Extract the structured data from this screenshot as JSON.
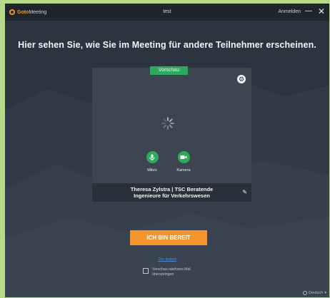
{
  "titlebar": {
    "brand": "Goto",
    "product": "Meeting",
    "title": "test",
    "signin_label": "Anmelden",
    "minimize_glyph": "—",
    "close_glyph": "✕"
  },
  "headline": "Hier sehen Sie, wie Sie im Meeting für andere Teilnehmer erscheinen.",
  "preview": {
    "tag": "Vorschau",
    "settings_icon": "gear-icon",
    "controls": {
      "mic_label": "Mikro",
      "camera_label": "Kamera"
    },
    "name_line1": "Theresa Zylstra | TSC Beratende",
    "name_line2": "Ingenieure für Verkehrswesen"
  },
  "ready_button": "ICH BIN BEREIT",
  "test_link": "Ton testen",
  "skip": {
    "line1": "Vorschau nächstes Mal",
    "line2": "überspringen"
  },
  "language": "Deutsch",
  "colors": {
    "accent_orange": "#f5942c",
    "accent_green": "#2eaa5e",
    "background": "#2c3440",
    "link_blue": "#4c8fd6"
  }
}
